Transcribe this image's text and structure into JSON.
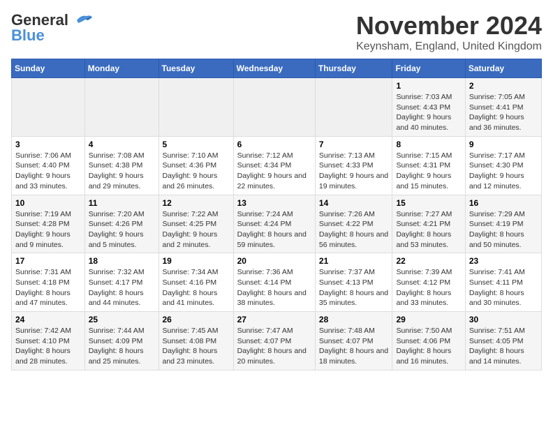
{
  "logo": {
    "text_general": "General",
    "text_blue": "Blue"
  },
  "title": "November 2024",
  "location": "Keynsham, England, United Kingdom",
  "days_of_week": [
    "Sunday",
    "Monday",
    "Tuesday",
    "Wednesday",
    "Thursday",
    "Friday",
    "Saturday"
  ],
  "weeks": [
    [
      {
        "day": "",
        "info": ""
      },
      {
        "day": "",
        "info": ""
      },
      {
        "day": "",
        "info": ""
      },
      {
        "day": "",
        "info": ""
      },
      {
        "day": "",
        "info": ""
      },
      {
        "day": "1",
        "info": "Sunrise: 7:03 AM\nSunset: 4:43 PM\nDaylight: 9 hours and 40 minutes."
      },
      {
        "day": "2",
        "info": "Sunrise: 7:05 AM\nSunset: 4:41 PM\nDaylight: 9 hours and 36 minutes."
      }
    ],
    [
      {
        "day": "3",
        "info": "Sunrise: 7:06 AM\nSunset: 4:40 PM\nDaylight: 9 hours and 33 minutes."
      },
      {
        "day": "4",
        "info": "Sunrise: 7:08 AM\nSunset: 4:38 PM\nDaylight: 9 hours and 29 minutes."
      },
      {
        "day": "5",
        "info": "Sunrise: 7:10 AM\nSunset: 4:36 PM\nDaylight: 9 hours and 26 minutes."
      },
      {
        "day": "6",
        "info": "Sunrise: 7:12 AM\nSunset: 4:34 PM\nDaylight: 9 hours and 22 minutes."
      },
      {
        "day": "7",
        "info": "Sunrise: 7:13 AM\nSunset: 4:33 PM\nDaylight: 9 hours and 19 minutes."
      },
      {
        "day": "8",
        "info": "Sunrise: 7:15 AM\nSunset: 4:31 PM\nDaylight: 9 hours and 15 minutes."
      },
      {
        "day": "9",
        "info": "Sunrise: 7:17 AM\nSunset: 4:30 PM\nDaylight: 9 hours and 12 minutes."
      }
    ],
    [
      {
        "day": "10",
        "info": "Sunrise: 7:19 AM\nSunset: 4:28 PM\nDaylight: 9 hours and 9 minutes."
      },
      {
        "day": "11",
        "info": "Sunrise: 7:20 AM\nSunset: 4:26 PM\nDaylight: 9 hours and 5 minutes."
      },
      {
        "day": "12",
        "info": "Sunrise: 7:22 AM\nSunset: 4:25 PM\nDaylight: 9 hours and 2 minutes."
      },
      {
        "day": "13",
        "info": "Sunrise: 7:24 AM\nSunset: 4:24 PM\nDaylight: 8 hours and 59 minutes."
      },
      {
        "day": "14",
        "info": "Sunrise: 7:26 AM\nSunset: 4:22 PM\nDaylight: 8 hours and 56 minutes."
      },
      {
        "day": "15",
        "info": "Sunrise: 7:27 AM\nSunset: 4:21 PM\nDaylight: 8 hours and 53 minutes."
      },
      {
        "day": "16",
        "info": "Sunrise: 7:29 AM\nSunset: 4:19 PM\nDaylight: 8 hours and 50 minutes."
      }
    ],
    [
      {
        "day": "17",
        "info": "Sunrise: 7:31 AM\nSunset: 4:18 PM\nDaylight: 8 hours and 47 minutes."
      },
      {
        "day": "18",
        "info": "Sunrise: 7:32 AM\nSunset: 4:17 PM\nDaylight: 8 hours and 44 minutes."
      },
      {
        "day": "19",
        "info": "Sunrise: 7:34 AM\nSunset: 4:16 PM\nDaylight: 8 hours and 41 minutes."
      },
      {
        "day": "20",
        "info": "Sunrise: 7:36 AM\nSunset: 4:14 PM\nDaylight: 8 hours and 38 minutes."
      },
      {
        "day": "21",
        "info": "Sunrise: 7:37 AM\nSunset: 4:13 PM\nDaylight: 8 hours and 35 minutes."
      },
      {
        "day": "22",
        "info": "Sunrise: 7:39 AM\nSunset: 4:12 PM\nDaylight: 8 hours and 33 minutes."
      },
      {
        "day": "23",
        "info": "Sunrise: 7:41 AM\nSunset: 4:11 PM\nDaylight: 8 hours and 30 minutes."
      }
    ],
    [
      {
        "day": "24",
        "info": "Sunrise: 7:42 AM\nSunset: 4:10 PM\nDaylight: 8 hours and 28 minutes."
      },
      {
        "day": "25",
        "info": "Sunrise: 7:44 AM\nSunset: 4:09 PM\nDaylight: 8 hours and 25 minutes."
      },
      {
        "day": "26",
        "info": "Sunrise: 7:45 AM\nSunset: 4:08 PM\nDaylight: 8 hours and 23 minutes."
      },
      {
        "day": "27",
        "info": "Sunrise: 7:47 AM\nSunset: 4:07 PM\nDaylight: 8 hours and 20 minutes."
      },
      {
        "day": "28",
        "info": "Sunrise: 7:48 AM\nSunset: 4:07 PM\nDaylight: 8 hours and 18 minutes."
      },
      {
        "day": "29",
        "info": "Sunrise: 7:50 AM\nSunset: 4:06 PM\nDaylight: 8 hours and 16 minutes."
      },
      {
        "day": "30",
        "info": "Sunrise: 7:51 AM\nSunset: 4:05 PM\nDaylight: 8 hours and 14 minutes."
      }
    ]
  ]
}
